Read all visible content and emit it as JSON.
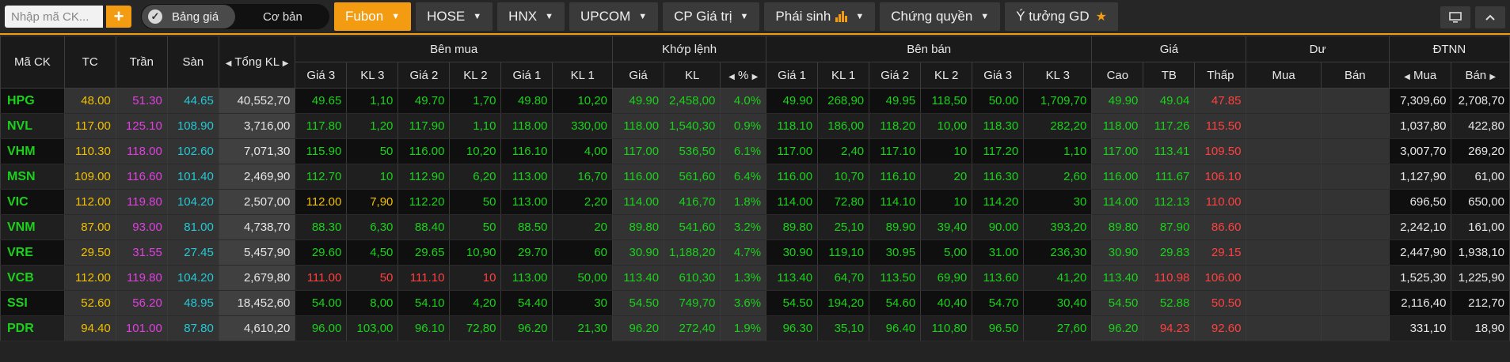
{
  "topbar": {
    "search_placeholder": "Nhập mã CK...",
    "plus_label": "+",
    "toggle_on": "Bảng giá",
    "toggle_off": "Cơ bản",
    "nav": [
      {
        "label": "Fubon",
        "active": true
      },
      {
        "label": "HOSE"
      },
      {
        "label": "HNX"
      },
      {
        "label": "UPCOM"
      },
      {
        "label": "CP Giá trị"
      },
      {
        "label": "Phái sinh"
      },
      {
        "label": "Chứng quyền"
      },
      {
        "label": "Ý tưởng GD"
      }
    ]
  },
  "header": {
    "group": {
      "symbol": "Mã CK",
      "ref": "TC",
      "ceil": "Trần",
      "floor": "Sàn",
      "total": "Tổng KL",
      "buy": "Bên mua",
      "match": "Khớp lệnh",
      "sell": "Bên bán",
      "price": "Giá",
      "residual": "Dư",
      "foreign": "ĐTNN"
    },
    "sub": {
      "b3": "Giá 3",
      "bk3": "KL 3",
      "b2": "Giá 2",
      "bk2": "KL 2",
      "b1": "Giá 1",
      "bk1": "KL 1",
      "mp": "Giá",
      "mk": "KL",
      "pct": "%",
      "s1": "Giá 1",
      "sk1": "KL 1",
      "s2": "Giá 2",
      "sk2": "KL 2",
      "s3": "Giá 3",
      "sk3": "KL 3",
      "high": "Cao",
      "avg": "TB",
      "low": "Thấp",
      "rbuy": "Mua",
      "rsell": "Bán",
      "fbuy": "Mua",
      "fsell": "Bán"
    }
  },
  "colors": {
    "up": "#1bd11b",
    "down": "#ff4040",
    "ref": "#f0c000",
    "ceil": "#e040e0",
    "floor": "#27c7d4",
    "accent": "#f39c12"
  },
  "rows": [
    {
      "sym": "HPG",
      "tc": "48.00",
      "tran": "51.30",
      "san": "44.65",
      "tkl": "40,552,70",
      "b3": "49.65",
      "bk3": "1,10",
      "b2": "49.70",
      "bk2": "1,70",
      "b1": "49.80",
      "bk1": "10,20",
      "mp": "49.90",
      "mk": "2,458,00",
      "pct": "4.0%",
      "s1": "49.90",
      "sk1": "268,90",
      "s2": "49.95",
      "sk2": "118,50",
      "s3": "50.00",
      "sk3": "1,709,70",
      "high": "49.90",
      "avg": "49.04",
      "low": "47.85",
      "rbuy": "",
      "rsell": "",
      "fbuy": "7,309,60",
      "fsell": "2,708,70",
      "c": {
        "b3": "up",
        "b2": "up",
        "b1": "up",
        "mp": "up",
        "s1": "up",
        "s2": "up",
        "s3": "up",
        "high": "up",
        "avg": "up",
        "low": "down"
      }
    },
    {
      "sym": "NVL",
      "tc": "117.00",
      "tran": "125.10",
      "san": "108.90",
      "tkl": "3,716,00",
      "b3": "117.80",
      "bk3": "1,20",
      "b2": "117.90",
      "bk2": "1,10",
      "b1": "118.00",
      "bk1": "330,00",
      "mp": "118.00",
      "mk": "1,540,30",
      "pct": "0.9%",
      "s1": "118.10",
      "sk1": "186,00",
      "s2": "118.20",
      "sk2": "10,00",
      "s3": "118.30",
      "sk3": "282,20",
      "high": "118.00",
      "avg": "117.26",
      "low": "115.50",
      "rbuy": "",
      "rsell": "",
      "fbuy": "1,037,80",
      "fsell": "422,80",
      "c": {
        "b3": "up",
        "b2": "up",
        "b1": "up",
        "mp": "up",
        "s1": "up",
        "s2": "up",
        "s3": "up",
        "high": "up",
        "avg": "up",
        "low": "down"
      }
    },
    {
      "sym": "VHM",
      "tc": "110.30",
      "tran": "118.00",
      "san": "102.60",
      "tkl": "7,071,30",
      "b3": "115.90",
      "bk3": "50",
      "b2": "116.00",
      "bk2": "10,20",
      "b1": "116.10",
      "bk1": "4,00",
      "mp": "117.00",
      "mk": "536,50",
      "pct": "6.1%",
      "s1": "117.00",
      "sk1": "2,40",
      "s2": "117.10",
      "sk2": "10",
      "s3": "117.20",
      "sk3": "1,10",
      "high": "117.00",
      "avg": "113.41",
      "low": "109.50",
      "rbuy": "",
      "rsell": "",
      "fbuy": "3,007,70",
      "fsell": "269,20",
      "c": {
        "b3": "up",
        "b2": "up",
        "b1": "up",
        "mp": "up",
        "s1": "up",
        "s2": "up",
        "s3": "up",
        "high": "up",
        "avg": "up",
        "low": "down"
      }
    },
    {
      "sym": "MSN",
      "tc": "109.00",
      "tran": "116.60",
      "san": "101.40",
      "tkl": "2,469,90",
      "b3": "112.70",
      "bk3": "10",
      "b2": "112.90",
      "bk2": "6,20",
      "b1": "113.00",
      "bk1": "16,70",
      "mp": "116.00",
      "mk": "561,60",
      "pct": "6.4%",
      "s1": "116.00",
      "sk1": "10,70",
      "s2": "116.10",
      "sk2": "20",
      "s3": "116.30",
      "sk3": "2,60",
      "high": "116.00",
      "avg": "111.67",
      "low": "106.10",
      "rbuy": "",
      "rsell": "",
      "fbuy": "1,127,90",
      "fsell": "61,00",
      "c": {
        "b3": "up",
        "b2": "up",
        "b1": "up",
        "mp": "up",
        "s1": "up",
        "s2": "up",
        "s3": "up",
        "high": "up",
        "avg": "up",
        "low": "down"
      }
    },
    {
      "sym": "VIC",
      "tc": "112.00",
      "tran": "119.80",
      "san": "104.20",
      "tkl": "2,507,00",
      "b3": "112.00",
      "bk3": "7,90",
      "b2": "112.20",
      "bk2": "50",
      "b1": "113.00",
      "bk1": "2,20",
      "mp": "114.00",
      "mk": "416,70",
      "pct": "1.8%",
      "s1": "114.00",
      "sk1": "72,80",
      "s2": "114.10",
      "sk2": "10",
      "s3": "114.20",
      "sk3": "30",
      "high": "114.00",
      "avg": "112.13",
      "low": "110.00",
      "rbuy": "",
      "rsell": "",
      "fbuy": "696,50",
      "fsell": "650,00",
      "c": {
        "b3": "ref",
        "b2": "up",
        "b1": "up",
        "mp": "up",
        "s1": "up",
        "s2": "up",
        "s3": "up",
        "high": "up",
        "avg": "up",
        "low": "down"
      }
    },
    {
      "sym": "VNM",
      "tc": "87.00",
      "tran": "93.00",
      "san": "81.00",
      "tkl": "4,738,70",
      "b3": "88.30",
      "bk3": "6,30",
      "b2": "88.40",
      "bk2": "50",
      "b1": "88.50",
      "bk1": "20",
      "mp": "89.80",
      "mk": "541,60",
      "pct": "3.2%",
      "s1": "89.80",
      "sk1": "25,10",
      "s2": "89.90",
      "sk2": "39,40",
      "s3": "90.00",
      "sk3": "393,20",
      "high": "89.80",
      "avg": "87.90",
      "low": "86.60",
      "rbuy": "",
      "rsell": "",
      "fbuy": "2,242,10",
      "fsell": "161,00",
      "c": {
        "b3": "up",
        "b2": "up",
        "b1": "up",
        "mp": "up",
        "s1": "up",
        "s2": "up",
        "s3": "up",
        "high": "up",
        "avg": "up",
        "low": "down"
      }
    },
    {
      "sym": "VRE",
      "tc": "29.50",
      "tran": "31.55",
      "san": "27.45",
      "tkl": "5,457,90",
      "b3": "29.60",
      "bk3": "4,50",
      "b2": "29.65",
      "bk2": "10,90",
      "b1": "29.70",
      "bk1": "60",
      "mp": "30.90",
      "mk": "1,188,20",
      "pct": "4.7%",
      "s1": "30.90",
      "sk1": "119,10",
      "s2": "30.95",
      "sk2": "5,00",
      "s3": "31.00",
      "sk3": "236,30",
      "high": "30.90",
      "avg": "29.83",
      "low": "29.15",
      "rbuy": "",
      "rsell": "",
      "fbuy": "2,447,90",
      "fsell": "1,938,10",
      "c": {
        "b3": "up",
        "b2": "up",
        "b1": "up",
        "mp": "up",
        "s1": "up",
        "s2": "up",
        "s3": "up",
        "high": "up",
        "avg": "up",
        "low": "down"
      }
    },
    {
      "sym": "VCB",
      "tc": "112.00",
      "tran": "119.80",
      "san": "104.20",
      "tkl": "2,679,80",
      "b3": "111.00",
      "bk3": "50",
      "b2": "111.10",
      "bk2": "10",
      "b1": "113.00",
      "bk1": "50,00",
      "mp": "113.40",
      "mk": "610,30",
      "pct": "1.3%",
      "s1": "113.40",
      "sk1": "64,70",
      "s2": "113.50",
      "sk2": "69,90",
      "s3": "113.60",
      "sk3": "41,20",
      "high": "113.40",
      "avg": "110.98",
      "low": "106.00",
      "rbuy": "",
      "rsell": "",
      "fbuy": "1,525,30",
      "fsell": "1,225,90",
      "c": {
        "b3": "down",
        "b2": "down",
        "b1": "up",
        "mp": "up",
        "s1": "up",
        "s2": "up",
        "s3": "up",
        "high": "up",
        "avg": "down",
        "low": "down"
      }
    },
    {
      "sym": "SSI",
      "tc": "52.60",
      "tran": "56.20",
      "san": "48.95",
      "tkl": "18,452,60",
      "b3": "54.00",
      "bk3": "8,00",
      "b2": "54.10",
      "bk2": "4,20",
      "b1": "54.40",
      "bk1": "30",
      "mp": "54.50",
      "mk": "749,70",
      "pct": "3.6%",
      "s1": "54.50",
      "sk1": "194,20",
      "s2": "54.60",
      "sk2": "40,40",
      "s3": "54.70",
      "sk3": "30,40",
      "high": "54.50",
      "avg": "52.88",
      "low": "50.50",
      "rbuy": "",
      "rsell": "",
      "fbuy": "2,116,40",
      "fsell": "212,70",
      "c": {
        "b3": "up",
        "b2": "up",
        "b1": "up",
        "mp": "up",
        "s1": "up",
        "s2": "up",
        "s3": "up",
        "high": "up",
        "avg": "up",
        "low": "down"
      }
    },
    {
      "sym": "PDR",
      "tc": "94.40",
      "tran": "101.00",
      "san": "87.80",
      "tkl": "4,610,20",
      "b3": "96.00",
      "bk3": "103,00",
      "b2": "96.10",
      "bk2": "72,80",
      "b1": "96.20",
      "bk1": "21,30",
      "mp": "96.20",
      "mk": "272,40",
      "pct": "1.9%",
      "s1": "96.30",
      "sk1": "35,10",
      "s2": "96.40",
      "sk2": "110,80",
      "s3": "96.50",
      "sk3": "27,60",
      "high": "96.20",
      "avg": "94.23",
      "low": "92.60",
      "rbuy": "",
      "rsell": "",
      "fbuy": "331,10",
      "fsell": "18,90",
      "c": {
        "b3": "up",
        "b2": "up",
        "b1": "up",
        "mp": "up",
        "s1": "up",
        "s2": "up",
        "s3": "up",
        "high": "up",
        "avg": "down",
        "low": "down"
      }
    }
  ]
}
